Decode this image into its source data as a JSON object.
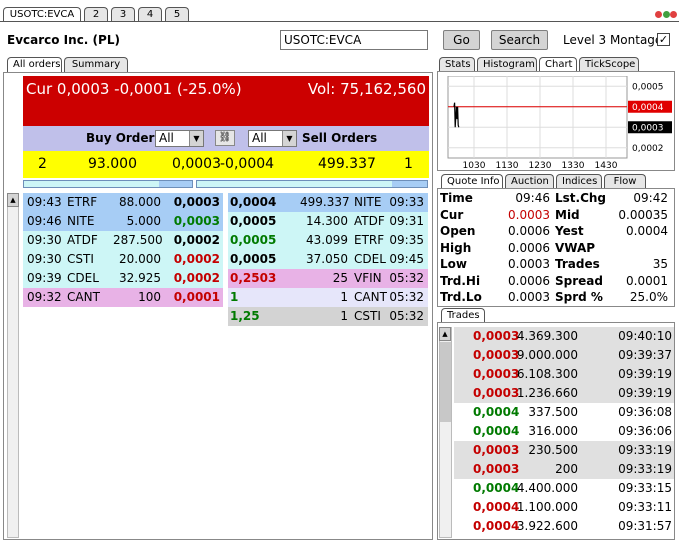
{
  "tabs": [
    "USOTC:EVCA",
    "2",
    "3",
    "4",
    "5"
  ],
  "header": {
    "company": "Evcarco Inc. (PL)",
    "symbol": "USOTC:EVCA",
    "go": "Go",
    "search": "Search",
    "montage": "Level 3 Montage",
    "montage_checked": true
  },
  "left_tabs": [
    "All orders",
    "Summary"
  ],
  "quote": {
    "cur": "Cur 0,0003 -0,0001 (-25.0%)",
    "vol": "Vol: 75,162,560"
  },
  "order_bar": {
    "buy_label": "Buy Orders",
    "sell_label": "Sell Orders",
    "buy_filter": "All",
    "sell_filter": "All"
  },
  "summary": {
    "bid_count": "2",
    "bid_size": "93.000",
    "bid": "0,0003",
    "ask": "-0,0004",
    "ask_size": "499.337",
    "ask_count": "1"
  },
  "bids": [
    {
      "time": "09:43",
      "mm": "ETRF",
      "size": "88.000",
      "price": "0,0003",
      "price_color": "#000000",
      "bg": "#a7cdf5"
    },
    {
      "time": "09:46",
      "mm": "NITE",
      "size": "5.000",
      "price": "0,0003",
      "price_color": "#007a00",
      "bg": "#a7cdf5"
    },
    {
      "time": "09:30",
      "mm": "ATDF",
      "size": "287.500",
      "price": "0,0002",
      "price_color": "#000000",
      "bg": "#cdf6f6"
    },
    {
      "time": "09:30",
      "mm": "CSTI",
      "size": "20.000",
      "price": "0,0002",
      "price_color": "#c40000",
      "bg": "#cdf6f6"
    },
    {
      "time": "09:39",
      "mm": "CDEL",
      "size": "32.925",
      "price": "0,0002",
      "price_color": "#c40000",
      "bg": "#cdf6f6"
    },
    {
      "time": "09:32",
      "mm": "CANT",
      "size": "100",
      "price": "0,0001",
      "price_color": "#c40000",
      "bg": "#e8b2e6"
    }
  ],
  "asks": [
    {
      "price": "0,0004",
      "price_color": "#000000",
      "size": "499.337",
      "mm": "NITE",
      "time": "09:33",
      "bg": "#a7cdf5"
    },
    {
      "price": "0,0005",
      "price_color": "#000000",
      "size": "14.300",
      "mm": "ATDF",
      "time": "09:31",
      "bg": "#cdf6f6"
    },
    {
      "price": "0,0005",
      "price_color": "#007a00",
      "size": "43.099",
      "mm": "ETRF",
      "time": "09:35",
      "bg": "#cdf6f6"
    },
    {
      "price": "0,0005",
      "price_color": "#000000",
      "size": "37.050",
      "mm": "CDEL",
      "time": "09:45",
      "bg": "#cdf6f6"
    },
    {
      "price": "0,2503",
      "price_color": "#c40000",
      "size": "25",
      "mm": "VFIN",
      "time": "05:32",
      "bg": "#e8b2e6"
    },
    {
      "price": "1",
      "price_color": "#007a00",
      "size": "1",
      "mm": "CANT",
      "time": "05:32",
      "bg": "#e6e6fa"
    },
    {
      "price": "1,25",
      "price_color": "#007a00",
      "size": "1",
      "mm": "CSTI",
      "time": "05:32",
      "bg": "#d3d3d3"
    }
  ],
  "right_tabs": [
    "Stats",
    "Histogram",
    "Chart",
    "TickScope"
  ],
  "chart_data": {
    "type": "line",
    "x_ticks": [
      "1030",
      "1130",
      "1230",
      "1330",
      "1430"
    ],
    "y_ticks": [
      "0,0005",
      "0,0004",
      "0,0003",
      "0,0002"
    ],
    "highlight_red": "0,0004",
    "highlight_black": "0,0003",
    "ylim": [
      0.00015,
      0.00055
    ],
    "ref_line": 0.0004,
    "series": [
      {
        "x": [
          0,
          1,
          2,
          3,
          4,
          5,
          6,
          7,
          8
        ],
        "y": [
          0.0004,
          0.00042,
          0.0003,
          0.00035,
          0.0004,
          0.00034,
          0.0004,
          0.00031,
          0.0003
        ]
      }
    ]
  },
  "info_tabs": [
    "Quote Info",
    "Auction",
    "Indices",
    "Flow"
  ],
  "quote_info": [
    {
      "l1": "Time",
      "v1": "09:46",
      "l2": "Lst.Chg",
      "v2": "09:42"
    },
    {
      "l1": "Cur",
      "v1": "0.0003",
      "l2": "Mid",
      "v2": "0.00035"
    },
    {
      "l1": "Open",
      "v1": "0.0006",
      "l2": "Yest",
      "v2": "0.0004"
    },
    {
      "l1": "High",
      "v1": "0.0006",
      "l2": "VWAP",
      "v2": ""
    },
    {
      "l1": "Low",
      "v1": "0.0003",
      "l2": "Trades",
      "v2": "35"
    },
    {
      "l1": "Trd.Hi",
      "v1": "0.0006",
      "l2": "Spread",
      "v2": "0.0001"
    },
    {
      "l1": "Trd.Lo",
      "v1": "0.0003",
      "l2": "Sprd %",
      "v2": "25.0%"
    }
  ],
  "trades_tab": "Trades",
  "trades": [
    {
      "price": "0,0003",
      "size": "4.369.300",
      "time": "09:40:10",
      "color": "#c40000",
      "bg": "#e0e0e0"
    },
    {
      "price": "0,0003",
      "size": "9.000.000",
      "time": "09:39:37",
      "color": "#c40000",
      "bg": "#e0e0e0"
    },
    {
      "price": "0,0003",
      "size": "6.108.300",
      "time": "09:39:19",
      "color": "#c40000",
      "bg": "#e0e0e0"
    },
    {
      "price": "0,0003",
      "size": "1.236.660",
      "time": "09:39:19",
      "color": "#c40000",
      "bg": "#e0e0e0"
    },
    {
      "price": "0,0004",
      "size": "337.500",
      "time": "09:36:08",
      "color": "#007a00",
      "bg": "#ffffff"
    },
    {
      "price": "0,0004",
      "size": "316.000",
      "time": "09:36:06",
      "color": "#007a00",
      "bg": "#ffffff"
    },
    {
      "price": "0,0003",
      "size": "230.500",
      "time": "09:33:19",
      "color": "#c40000",
      "bg": "#e0e0e0"
    },
    {
      "price": "0,0003",
      "size": "200",
      "time": "09:33:19",
      "color": "#c40000",
      "bg": "#e0e0e0"
    },
    {
      "price": "0,0004",
      "size": "4.400.000",
      "time": "09:33:15",
      "color": "#007a00",
      "bg": "#ffffff"
    },
    {
      "price": "0,0004",
      "size": "1.100.000",
      "time": "09:33:11",
      "color": "#c40000",
      "bg": "#ffffff"
    },
    {
      "price": "0,0004",
      "size": "3.922.600",
      "time": "09:31:57",
      "color": "#c40000",
      "bg": "#ffffff"
    }
  ]
}
